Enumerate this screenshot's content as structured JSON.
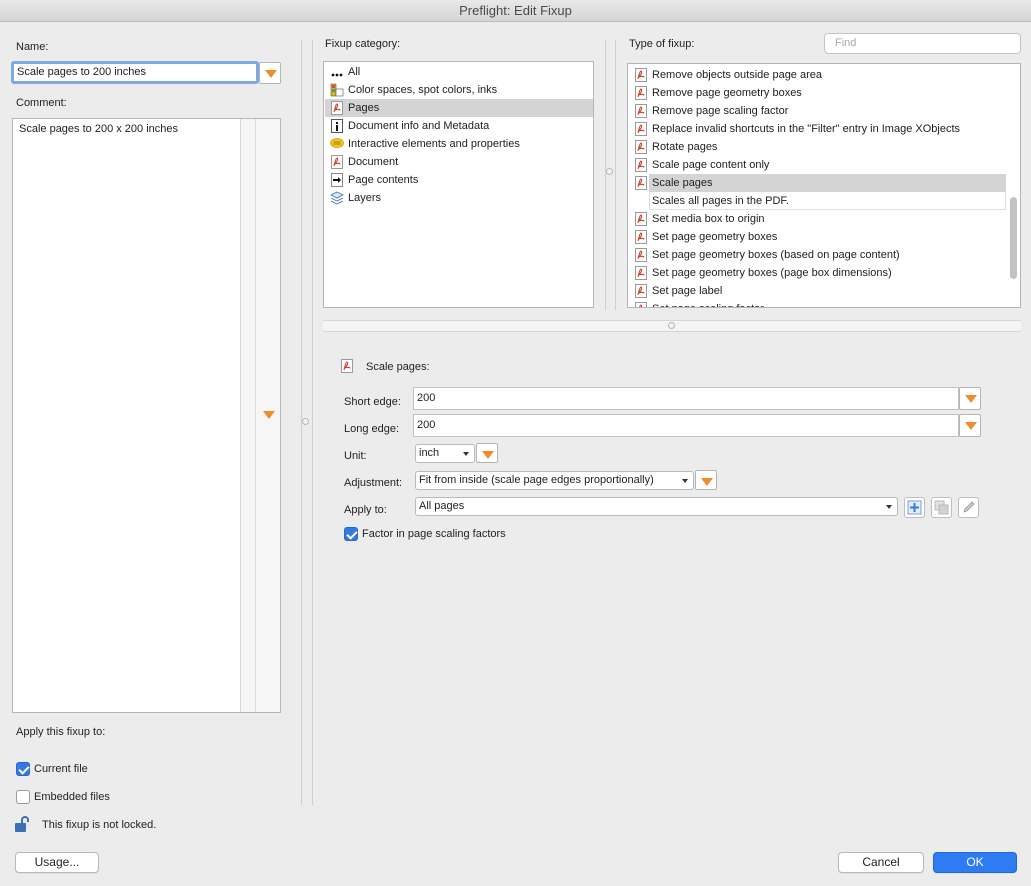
{
  "window": {
    "title": "Preflight: Edit Fixup"
  },
  "left": {
    "name_label": "Name:",
    "name_value": "Scale pages to 200 inches",
    "comment_label": "Comment:",
    "comment_value": "Scale pages to 200 x 200 inches",
    "apply_label": "Apply this fixup to:",
    "current_file_label": "Current file",
    "current_file_checked": true,
    "embedded_files_label": "Embedded files",
    "embedded_files_checked": false,
    "lock_status": "This fixup is not locked."
  },
  "category": {
    "label": "Fixup category:",
    "items": [
      {
        "label": "All",
        "icon": "ellipsis-icon"
      },
      {
        "label": "Color spaces, spot colors, inks",
        "icon": "color-palette-icon"
      },
      {
        "label": "Pages",
        "icon": "pdf-page-icon",
        "selected": true
      },
      {
        "label": "Document info and Metadata",
        "icon": "info-icon"
      },
      {
        "label": "Interactive elements and properties",
        "icon": "comment-bubble-icon"
      },
      {
        "label": "Document",
        "icon": "pdf-document-icon"
      },
      {
        "label": "Page contents",
        "icon": "page-contents-icon"
      },
      {
        "label": "Layers",
        "icon": "layers-icon"
      }
    ]
  },
  "types": {
    "label": "Type of fixup:",
    "find_placeholder": "Find",
    "items": [
      "Remove objects outside page area",
      "Remove page geometry boxes",
      "Remove page scaling factor",
      "Replace invalid shortcuts in the \"Filter\" entry in Image XObjects",
      "Rotate pages",
      "Scale page content only",
      "Scale pages",
      "Set media box to origin",
      "Set page geometry boxes",
      "Set page geometry boxes (based on page content)",
      "Set page geometry boxes (page box dimensions)",
      "Set page label",
      "Set page scaling factor"
    ],
    "selected": "Scale pages",
    "selected_description": "Scales all pages in the PDF."
  },
  "form": {
    "section_title": "Scale pages:",
    "short_edge_label": "Short edge:",
    "short_edge_value": "200",
    "long_edge_label": "Long edge:",
    "long_edge_value": "200",
    "unit_label": "Unit:",
    "unit_value": "inch",
    "adjustment_label": "Adjustment:",
    "adjustment_value": "Fit from inside (scale page edges proportionally)",
    "apply_to_label": "Apply to:",
    "apply_to_value": "All pages",
    "factor_label": "Factor in page scaling factors",
    "factor_checked": true
  },
  "buttons": {
    "usage": "Usage...",
    "cancel": "Cancel",
    "ok": "OK"
  },
  "colors": {
    "accent": "#2d7cf4",
    "dropdown_arrow": "#ef8c2b",
    "selection": "#d4d4d4",
    "pdf_red": "#d23b2f"
  }
}
